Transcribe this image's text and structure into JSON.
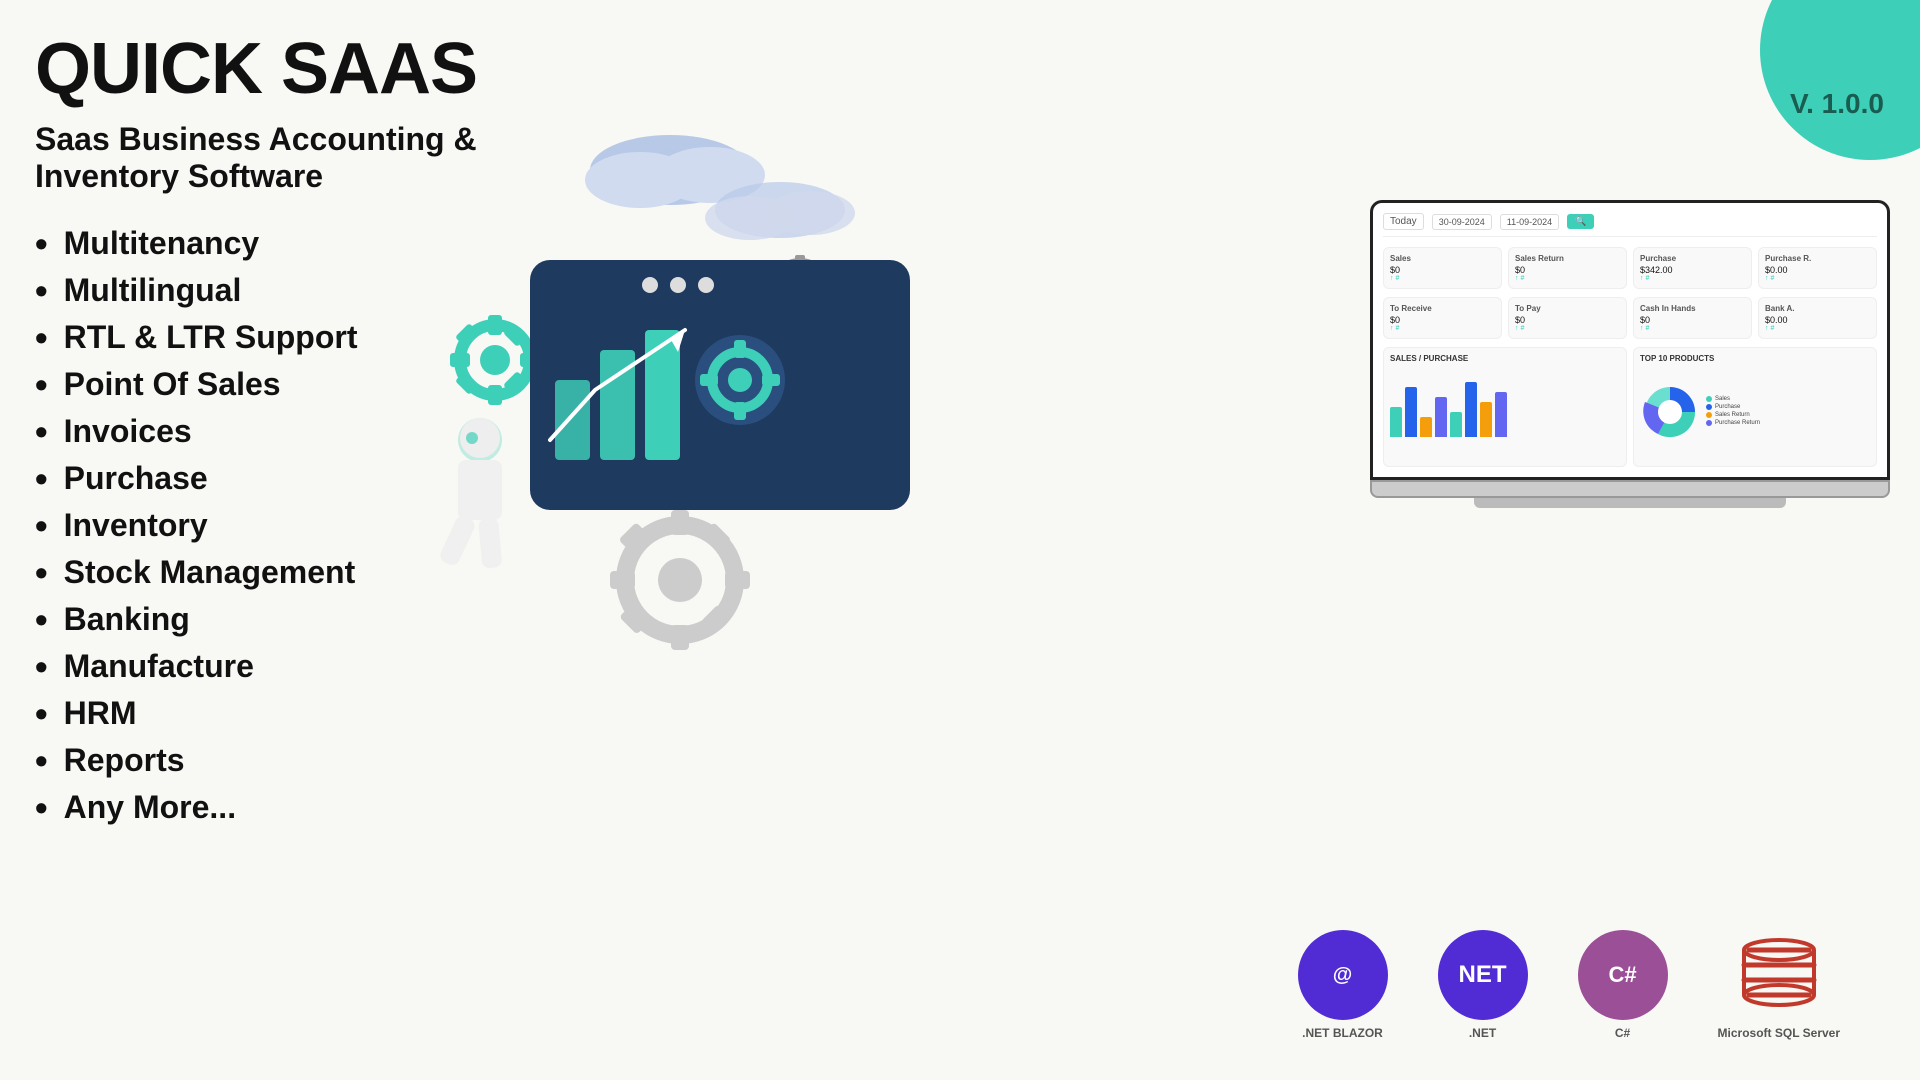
{
  "app": {
    "title": "QUICK SAAS",
    "subtitle": "Saas Business Accounting & Inventory Software",
    "version": "V. 1.0.0"
  },
  "features": [
    "Multitenancy",
    "Multilingual",
    "RTL & LTR Support",
    "Point Of Sales",
    "Invoices",
    "Purchase",
    "Inventory",
    "Stock Management",
    "Banking",
    "Manufacture",
    "HRM",
    "Reports",
    "Any More..."
  ],
  "dashboard": {
    "filter": "Today",
    "date1": "30-09-2024",
    "date2": "11-09-2024",
    "stats": [
      {
        "label": "Sales",
        "value": "$0",
        "sub": "↑ #"
      },
      {
        "label": "Sales Return",
        "value": "$0",
        "sub": "↑ #"
      },
      {
        "label": "Purchase",
        "value": "$342.00",
        "sub": "↑ #"
      },
      {
        "label": "Purchase R.",
        "value": "$0.00",
        "sub": "↑ #"
      }
    ],
    "stats2": [
      {
        "label": "To Receive",
        "value": "$0",
        "sub": "↑ #"
      },
      {
        "label": "To Pay",
        "value": "$0",
        "sub": "↑ #"
      },
      {
        "label": "Cash In Hands",
        "value": "$0",
        "sub": "↑ #"
      },
      {
        "label": "Bank A.",
        "value": "$0.00",
        "sub": "↑ #"
      }
    ],
    "chart1_title": "SALES / PURCHASE",
    "chart2_title": "TOP 10 PRODUCTS",
    "legend": [
      {
        "label": "Sales",
        "color": "#3ecfb8"
      },
      {
        "label": "Purchase",
        "color": "#2563eb"
      },
      {
        "label": "Sales Return",
        "color": "#f59e0b"
      },
      {
        "label": "Purchase Return",
        "color": "#6366f1"
      }
    ]
  },
  "tech_logos": [
    {
      "name": ".NET BLAZOR",
      "icon": "@",
      "color": "#3b3b8f"
    },
    {
      "name": ".NET",
      "icon": "NET",
      "color": "#5c2d91"
    },
    {
      "name": "C#",
      "icon": "C#",
      "color": "#9b4f96"
    },
    {
      "name": "SQL Server",
      "icon": "SQL",
      "color": "#e74c3c"
    }
  ],
  "colors": {
    "teal": "#3ecfb8",
    "navy": "#1e3a5f",
    "dark": "#111111",
    "bg": "#f5f5ef"
  }
}
